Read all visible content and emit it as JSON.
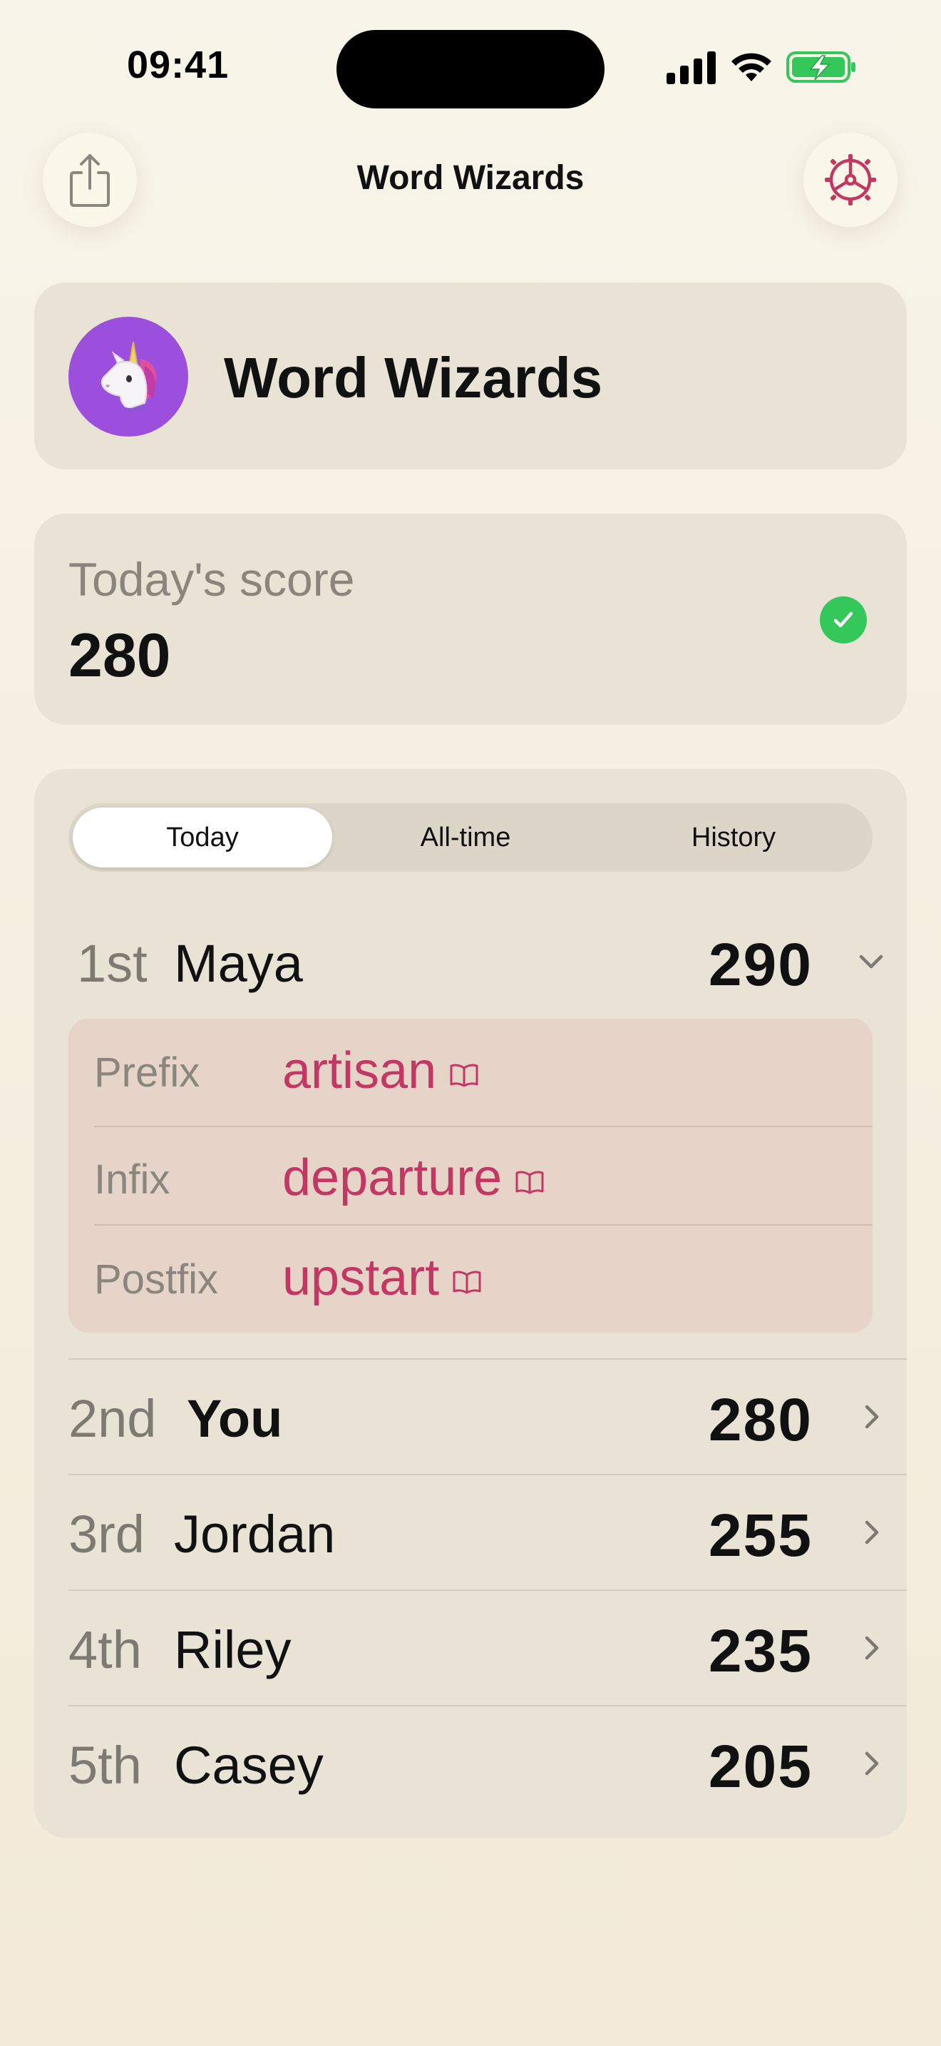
{
  "status_bar": {
    "time": "09:41"
  },
  "nav": {
    "title": "Word Wizards",
    "share_icon": "share-icon",
    "settings_icon": "settings-gear-icon",
    "accent_color": "#c23862"
  },
  "group": {
    "name": "Word Wizards",
    "avatar_icon": "unicorn-icon",
    "avatar_color": "#9b4fdc"
  },
  "score_card": {
    "label": "Today's score",
    "value": "280",
    "status_icon": "checkmark-circle-icon",
    "status_color": "#34c759"
  },
  "tabs": [
    {
      "label": "Today",
      "selected": true
    },
    {
      "label": "All-time",
      "selected": false
    },
    {
      "label": "History",
      "selected": false
    }
  ],
  "leaderboard": [
    {
      "rank": "1st",
      "name": "Maya",
      "score": "290",
      "expanded": true,
      "words": [
        {
          "label": "Prefix",
          "word": "artisan"
        },
        {
          "label": "Infix",
          "word": "departure"
        },
        {
          "label": "Postfix",
          "word": "upstart"
        }
      ]
    },
    {
      "rank": "2nd",
      "name": "You",
      "score": "280",
      "expanded": false
    },
    {
      "rank": "3rd",
      "name": "Jordan",
      "score": "255",
      "expanded": false
    },
    {
      "rank": "4th",
      "name": "Riley",
      "score": "235",
      "expanded": false
    },
    {
      "rank": "5th",
      "name": "Casey",
      "score": "205",
      "expanded": false
    }
  ]
}
